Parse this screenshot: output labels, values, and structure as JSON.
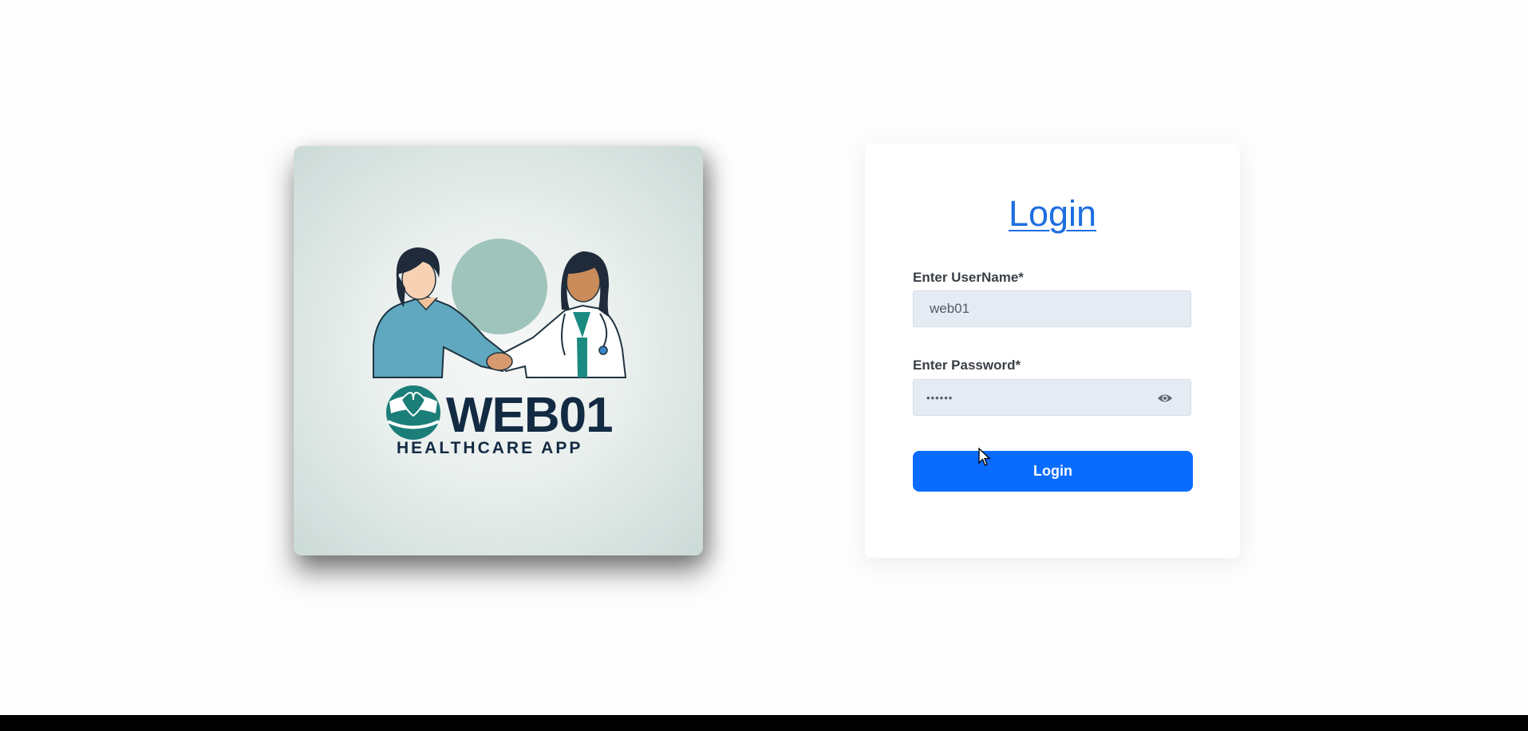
{
  "logo": {
    "title": "WEB01",
    "subtitle": "HEALTHCARE APP",
    "icon": "heart-hands-logo-icon",
    "colors": {
      "teal": "#1b7e78",
      "navy": "#132a43"
    }
  },
  "login": {
    "heading": "Login",
    "username_label": "Enter UserName*",
    "username_value": "web01",
    "password_label": "Enter Password*",
    "password_value": "••••••",
    "toggle_icon": "eye-icon",
    "submit_label": "Login"
  },
  "colors": {
    "accent": "#0a6cff",
    "link": "#1e6fe0",
    "field_bg": "#e5ebf3"
  }
}
